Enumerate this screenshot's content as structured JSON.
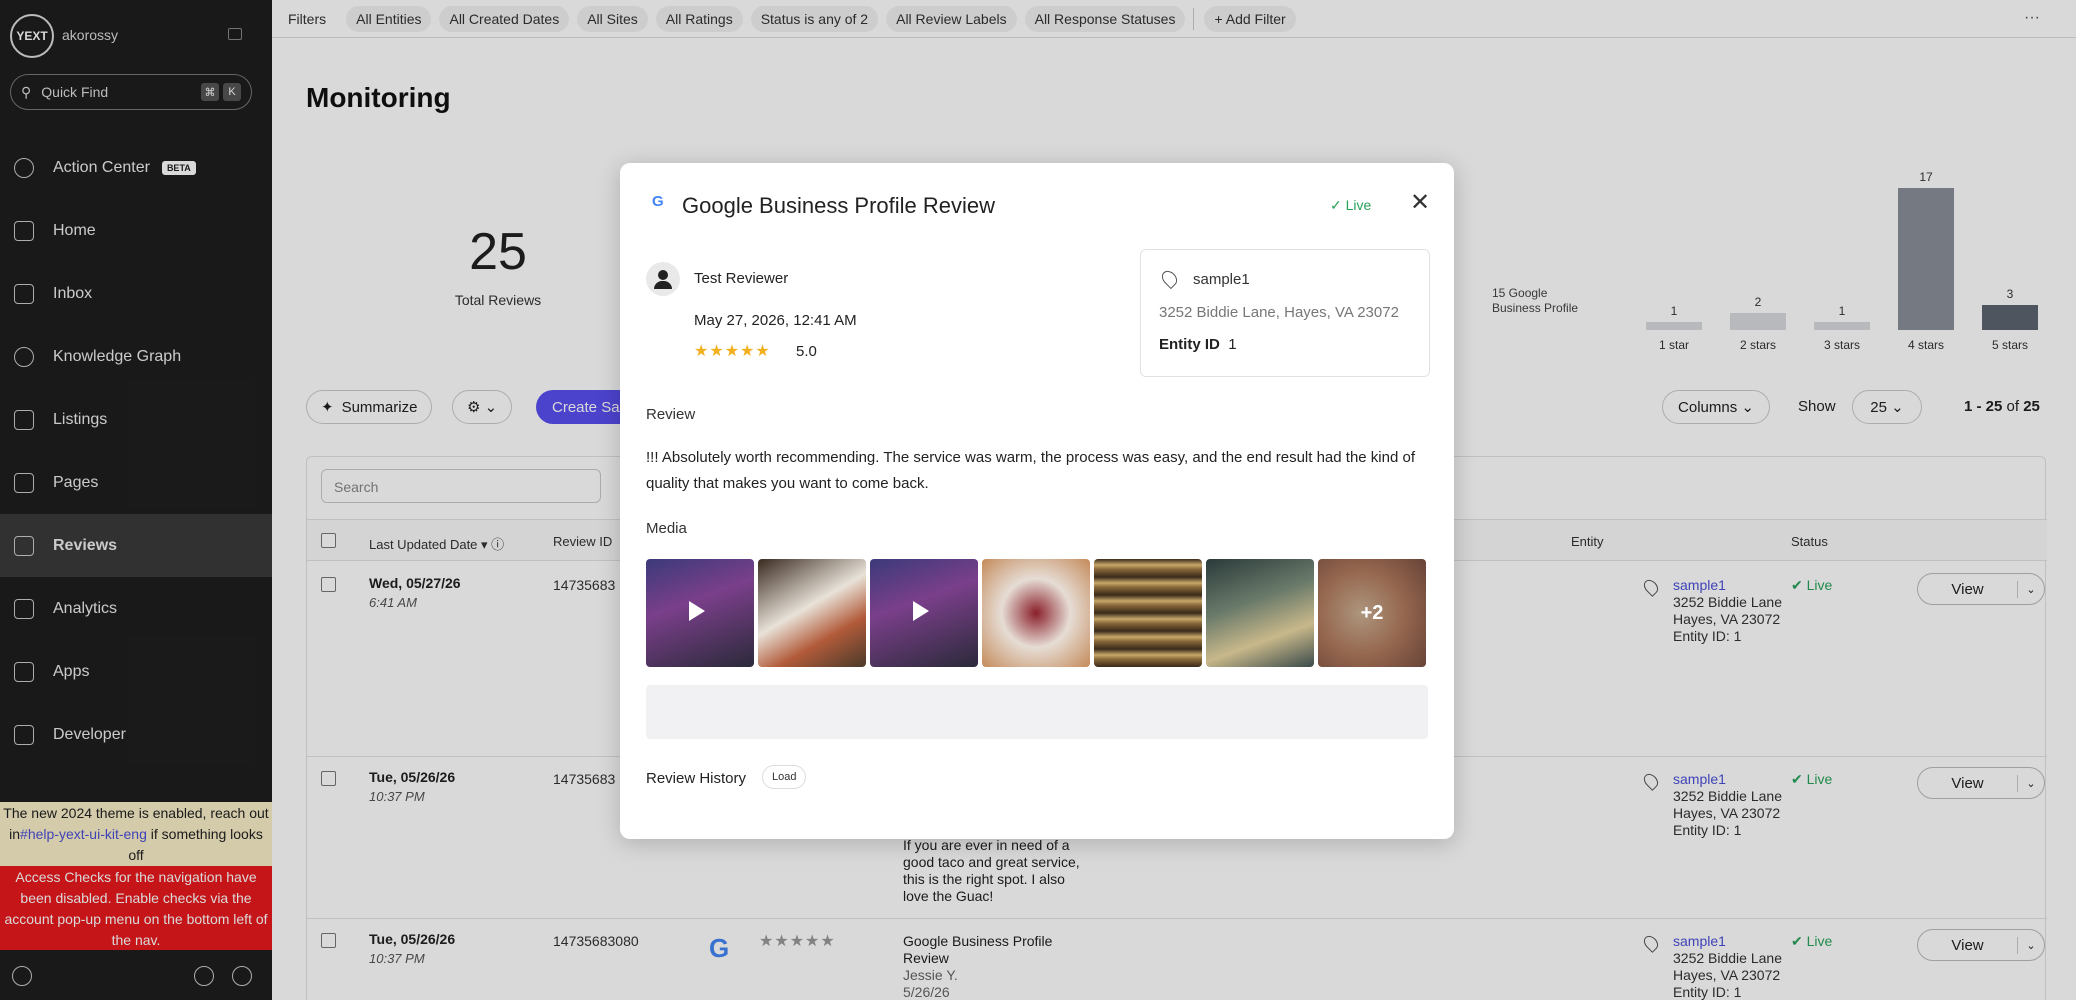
{
  "sidebar": {
    "logo_text": "YEXT",
    "username": "akorossy",
    "quick_find": "Quick Find",
    "kbd1": "⌘",
    "kbd2": "K",
    "items": [
      {
        "label": "Action Center",
        "badge": "BETA"
      },
      {
        "label": "Home"
      },
      {
        "label": "Inbox"
      },
      {
        "label": "Knowledge Graph"
      },
      {
        "label": "Listings"
      },
      {
        "label": "Pages"
      },
      {
        "label": "Reviews"
      },
      {
        "label": "Analytics"
      },
      {
        "label": "Apps"
      },
      {
        "label": "Developer"
      }
    ],
    "notice_yellow_pre": "The new 2024 theme is enabled, reach out in",
    "notice_yellow_link": "#help-yext-ui-kit-eng",
    "notice_yellow_post": " if something looks off",
    "notice_red": "Access Checks for the navigation have been disabled. Enable checks via the account pop-up menu on the bottom left of the nav."
  },
  "filters": {
    "label": "Filters",
    "chips": [
      "All Entities",
      "All Created Dates",
      "All Sites",
      "All Ratings",
      "Status is any of 2",
      "All Review Labels",
      "All Response Statuses"
    ],
    "add": "+ Add Filter",
    "more": "···"
  },
  "page": {
    "title": "Monitoring",
    "total_reviews": "25",
    "total_label": "Total Reviews",
    "donut_label_1": "15 Google",
    "donut_label_2": "Business Profile"
  },
  "chart_data": {
    "type": "bar",
    "categories": [
      "1 star",
      "2 stars",
      "3 stars",
      "4 stars",
      "5 stars"
    ],
    "values": [
      1,
      2,
      1,
      17,
      3
    ],
    "value_labels": [
      "1",
      "2",
      "1",
      "17",
      "3"
    ]
  },
  "toolbar": {
    "summarize": "Summarize",
    "create": "Create Sa",
    "columns": "Columns",
    "show_label": "Show",
    "show_value": "25",
    "pager_range": "1 - 25",
    "pager_of": " of ",
    "pager_total": "25"
  },
  "table": {
    "search_placeholder": "Search",
    "headers": {
      "date": "Last Updated Date",
      "review_id": "Review ID",
      "entity": "Entity",
      "status": "Status"
    },
    "rows": [
      {
        "date": "Wed, 05/27/26",
        "time": "6:41 AM",
        "id": "14735683",
        "entity_name": "sample1",
        "addr1": "3252 Biddie Lane",
        "addr2": "Hayes, VA 23072",
        "eid": "Entity ID: 1",
        "status": "✔ Live",
        "view": "View"
      },
      {
        "date": "Tue, 05/26/26",
        "time": "10:37 PM",
        "id": "14735683",
        "entity_name": "sample1",
        "addr1": "3252 Biddie Lane",
        "addr2": "Hayes, VA 23072",
        "eid": "Entity ID: 1",
        "status": "✔ Live",
        "view": "View",
        "text1": "If you are ever in need of a",
        "text2": "good taco and great service,",
        "text3": "this is the right spot. I also",
        "text4": "love the Guac!"
      },
      {
        "date": "Tue, 05/26/26",
        "time": "10:37 PM",
        "id": "14735683080",
        "entity_name": "sample1",
        "addr1": "3252 Biddie Lane",
        "addr2": "Hayes, VA 23072",
        "eid": "Entity ID: 1",
        "status": "✔ Live",
        "view": "View",
        "text1": "Google Business Profile",
        "text2": "Review",
        "text3": "Jessie Y.",
        "text4": "5/26/26",
        "stars": "★★★★★"
      }
    ]
  },
  "modal": {
    "g": "G",
    "title": "Google Business Profile Review",
    "live": "✓  Live",
    "close": "✕",
    "reviewer": "Test Reviewer",
    "date": "May 27, 2026, 12:41 AM",
    "stars": "★★★★★",
    "score": "5.0",
    "location_name": "sample1",
    "location_address": "3252 Biddie Lane, Hayes, VA 23072",
    "entity_label": "Entity ID",
    "entity_id": "1",
    "review_heading": "Review",
    "review_text": "!!! Absolutely worth recommending. The service was warm, the process was easy, and the end result had the kind of quality that makes you want to come back.",
    "media_heading": "Media",
    "media_more": "+2",
    "history": "Review History",
    "load": "Load"
  }
}
